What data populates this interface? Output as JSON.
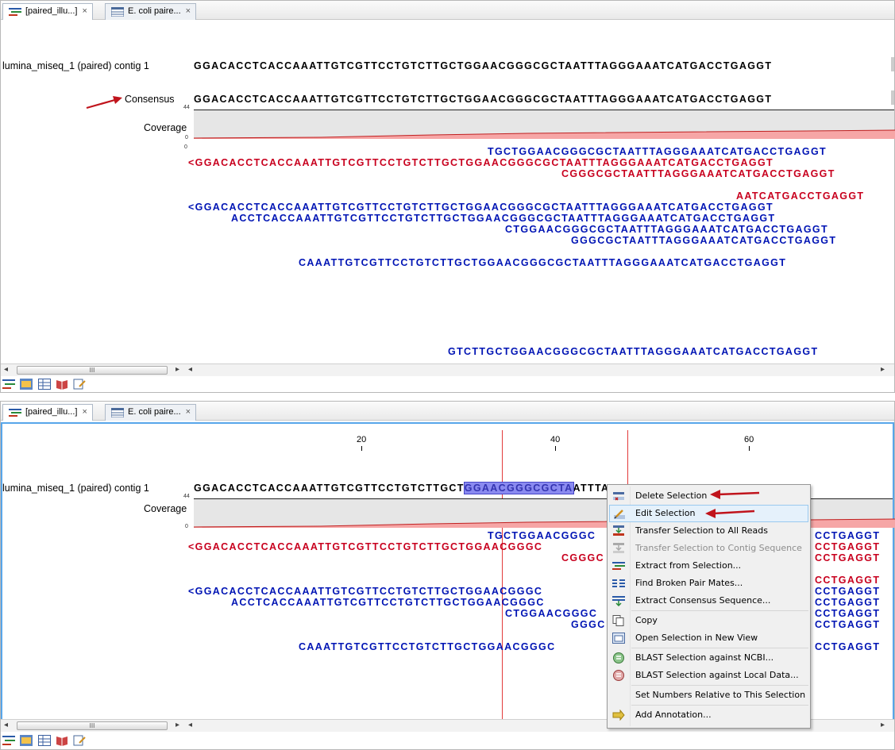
{
  "tabs": [
    {
      "label": "[paired_illu...]",
      "close": "×"
    },
    {
      "label": "E. coli paire...",
      "close": "×"
    }
  ],
  "contig_label": "lumina_miseq_1 (paired) contig 1",
  "consensus_label": "Consensus",
  "coverage_label": "Coverage",
  "coverage_max": "44",
  "coverage_min": "0",
  "reads_zero": "0",
  "contig_sequence": "GGACACCTCACCAAATTGTCGTTCCTGTCTTGCTGGAACGGGCGCTAATTTAGGGAAATCATGACCTGAGGT",
  "top_reads": [
    {
      "text": "TGCTGGAACGGGCGCTAATTTAGGGAAATCATGACCTGAGGT",
      "color": "blue"
    },
    {
      "text": "<GGACACCTCACCAAATTGTCGTTCCTGTCTTGCTGGAACGGGCGCTAATTTAGGGAAATCATGACCTGAGGT",
      "color": "red"
    },
    {
      "text": "CGGGCGCTAATTTAGGGAAATCATGACCTGAGGT",
      "color": "red"
    },
    {
      "text": "AATCATGACCTGAGGT",
      "color": "red"
    },
    {
      "text": "<GGACACCTCACCAAATTGTCGTTCCTGTCTTGCTGGAACGGGCGCTAATTTAGGGAAATCATGACCTGAGGT",
      "color": "blue"
    },
    {
      "text": "ACCTCACCAAATTGTCGTTCCTGTCTTGCTGGAACGGGCGCTAATTTAGGGAAATCATGACCTGAGGT",
      "color": "blue"
    },
    {
      "text": "CTGGAACGGGCGCTAATTTAGGGAAATCATGACCTGAGGT",
      "color": "blue"
    },
    {
      "text": "GGGCGCTAATTTAGGGAAATCATGACCTGAGGT",
      "color": "blue"
    },
    {
      "text": "CAAATTGTCGTTCCTGTCTTGCTGGAACGGGCGCTAATTTAGGGAAATCATGACCTGAGGT",
      "color": "blue"
    },
    {
      "text": "GTCTTGCTGGAACGGGCGCTAATTTAGGGAAATCATGACCTGAGGT",
      "color": "blue"
    }
  ],
  "ruler": [
    "20",
    "40",
    "60"
  ],
  "bottom_contig_left": "GGACACCTCACCAAATTGTCGTTCCTGTCTTGCT",
  "bottom_contig_selected": "GGAACGGGCGCTA",
  "bottom_contig_right": "ATTTAGGGAAATCATGACCTGAGGT",
  "bottom_reads_left": [
    {
      "text": "TGCTGGAACGGGC",
      "color": "blue"
    },
    {
      "text": "<GGACACCTCACCAAATTGTCGTTCCTGTCTTGCTGGAACGGGC",
      "color": "red"
    },
    {
      "text": "CGGGC",
      "color": "red"
    },
    {
      "text": "<GGACACCTCACCAAATTGTCGTTCCTGTCTTGCTGGAACGGGC",
      "color": "blue"
    },
    {
      "text": "ACCTCACCAAATTGTCGTTCCTGTCTTGCTGGAACGGGC",
      "color": "blue"
    },
    {
      "text": "CTGGAACGGGC",
      "color": "blue"
    },
    {
      "text": "GGGC",
      "color": "blue"
    },
    {
      "text": "CAAATTGTCGTTCCTGTCTTGCTGGAACGGGC",
      "color": "blue"
    }
  ],
  "bottom_reads_right": [
    {
      "text": "CCTGAGGT",
      "color": "blue"
    },
    {
      "text": "CCTGAGGT",
      "color": "red"
    },
    {
      "text": "CCTGAGGT",
      "color": "red"
    },
    {
      "text": "CCTGAGGT",
      "color": "red"
    },
    {
      "text": "CCTGAGGT",
      "color": "blue"
    },
    {
      "text": "CCTGAGGT",
      "color": "blue"
    },
    {
      "text": "CCTGAGGT",
      "color": "blue"
    },
    {
      "text": "CCTGAGGT",
      "color": "blue"
    },
    {
      "text": "CCTGAGGT",
      "color": "blue"
    }
  ],
  "scroll_grip": "III",
  "context_menu": [
    {
      "label": "Delete Selection",
      "icon": "delete-selection-icon"
    },
    {
      "label": "Edit Selection",
      "icon": "edit-selection-icon",
      "highlighted": true
    },
    {
      "label": "Transfer Selection to All Reads",
      "icon": "transfer-reads-icon"
    },
    {
      "label": "Transfer Selection to Contig Sequence",
      "icon": "transfer-contig-icon",
      "disabled": true
    },
    {
      "label": "Extract from Selection...",
      "icon": "extract-icon"
    },
    {
      "label": "Find Broken Pair Mates...",
      "icon": "broken-pairs-icon"
    },
    {
      "label": "Extract Consensus Sequence...",
      "icon": "consensus-icon"
    },
    {
      "label": "Copy",
      "icon": "copy-icon"
    },
    {
      "label": "Open Selection in New View",
      "icon": "new-view-icon"
    },
    {
      "label": "BLAST Selection against NCBI...",
      "icon": "blast-ncbi-icon"
    },
    {
      "label": "BLAST Selection against Local Data...",
      "icon": "blast-local-icon"
    },
    {
      "label": "Set Numbers Relative to This Selection",
      "icon": ""
    },
    {
      "label": "Add Annotation...",
      "icon": "add-annotation-icon"
    }
  ],
  "colors": {
    "red_read": "#c8001e",
    "blue_read": "#0014b4",
    "arrow": "#c0141c",
    "selection": "#8a8af0"
  }
}
